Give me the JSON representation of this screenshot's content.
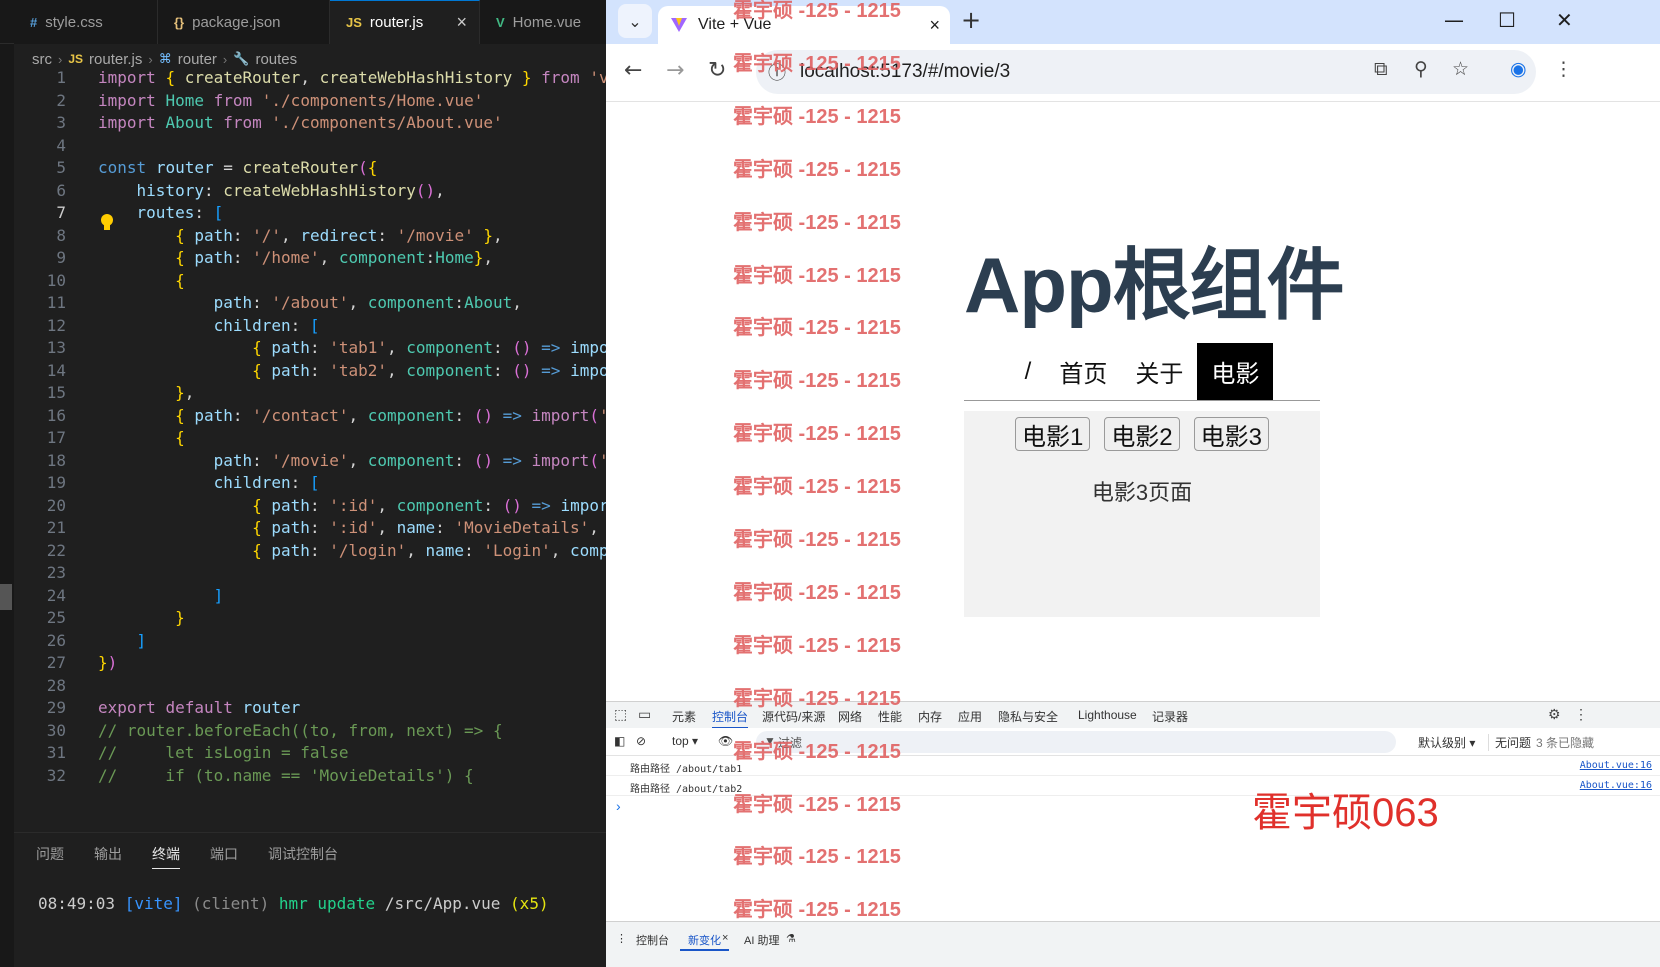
{
  "vscode": {
    "tabs": [
      {
        "icon": "#",
        "label": "style.css"
      },
      {
        "icon": "{}",
        "label": "package.json"
      },
      {
        "icon": "JS",
        "label": "router.js",
        "active": true
      },
      {
        "icon": "V",
        "label": "Home.vue"
      }
    ],
    "breadcrumb": [
      "src",
      "router.js",
      "router",
      "routes"
    ],
    "lines": [
      {
        "n": "1",
        "t": "import { createRouter, createWebHashHistory } from 'v"
      },
      {
        "n": "2",
        "t": "import Home from './components/Home.vue'"
      },
      {
        "n": "3",
        "t": "import About from './components/About.vue'"
      },
      {
        "n": "4",
        "t": ""
      },
      {
        "n": "5",
        "t": "const router = createRouter({"
      },
      {
        "n": "6",
        "t": "    history: createWebHashHistory(),"
      },
      {
        "n": "7",
        "t": "    routes: ["
      },
      {
        "n": "8",
        "t": "        { path: '/', redirect: '/movie' },"
      },
      {
        "n": "9",
        "t": "        { path: '/home', component:Home},"
      },
      {
        "n": "10",
        "t": "        {"
      },
      {
        "n": "11",
        "t": "            path: '/about', component:About,"
      },
      {
        "n": "12",
        "t": "            children: ["
      },
      {
        "n": "13",
        "t": "                { path: 'tab1', component: () => impo"
      },
      {
        "n": "14",
        "t": "                { path: 'tab2', component: () => impo"
      },
      {
        "n": "15",
        "t": "        },"
      },
      {
        "n": "16",
        "t": "        { path: '/contact', component: () => import('"
      },
      {
        "n": "17",
        "t": "        {"
      },
      {
        "n": "18",
        "t": "            path: '/movie', component: () => import('"
      },
      {
        "n": "19",
        "t": "            children: ["
      },
      {
        "n": "20",
        "t": "                { path: ':id', component: () => impor"
      },
      {
        "n": "21",
        "t": "                { path: ':id', name: 'MovieDetails',"
      },
      {
        "n": "22",
        "t": "                { path: '/login', name: 'Login', comp"
      },
      {
        "n": "23",
        "t": ""
      },
      {
        "n": "24",
        "t": "            ]"
      },
      {
        "n": "25",
        "t": "        }"
      },
      {
        "n": "26",
        "t": "    ]"
      },
      {
        "n": "27",
        "t": "})"
      },
      {
        "n": "28",
        "t": ""
      },
      {
        "n": "29",
        "t": "export default router"
      },
      {
        "n": "30",
        "t": "// router.beforeEach((to, from, next) => {"
      },
      {
        "n": "31",
        "t": "//     let isLogin = false"
      },
      {
        "n": "32",
        "t": "//     if (to.name == 'MovieDetails') {"
      }
    ],
    "panel_tabs": [
      "问题",
      "输出",
      "终端",
      "端口",
      "调试控制台"
    ],
    "terminal": {
      "time": "08:49:03",
      "tag": "[vite]",
      "client": "(client)",
      "msg": "hmr update",
      "path": "/src/App.vue",
      "count": "(x5)"
    }
  },
  "browser": {
    "tab_title": "Vite + Vue",
    "url": "localhost:5173/#/movie/3",
    "page": {
      "title": "App根组件",
      "nav": [
        "/",
        "首页",
        "关于",
        "电影"
      ],
      "active_nav": "电影",
      "movie_buttons": [
        "电影1",
        "电影2",
        "电影3"
      ],
      "movie_page_text": "电影3页面"
    },
    "devtools": {
      "tabs": [
        "元素",
        "控制台",
        "源代码/来源",
        "网络",
        "性能",
        "内存",
        "应用",
        "隐私与安全",
        "Lighthouse",
        "记录器"
      ],
      "active_tab": "控制台",
      "context": "top",
      "filter_label": "过滤",
      "level": "默认级别",
      "no_issues": "无问题",
      "hidden": "3 条已隐藏",
      "logs": [
        {
          "text": "路由路径 /about/tab1",
          "source": "About.vue:16"
        },
        {
          "text": "路由路径 /about/tab2",
          "source": "About.vue:16"
        }
      ],
      "prompt": "›",
      "bottom_tabs": [
        "控制台",
        "新变化",
        "AI 助理"
      ],
      "active_bottom": "新变化"
    }
  },
  "watermark": "霍宇硕 -125 - 1215",
  "signature": "霍宇硕063"
}
